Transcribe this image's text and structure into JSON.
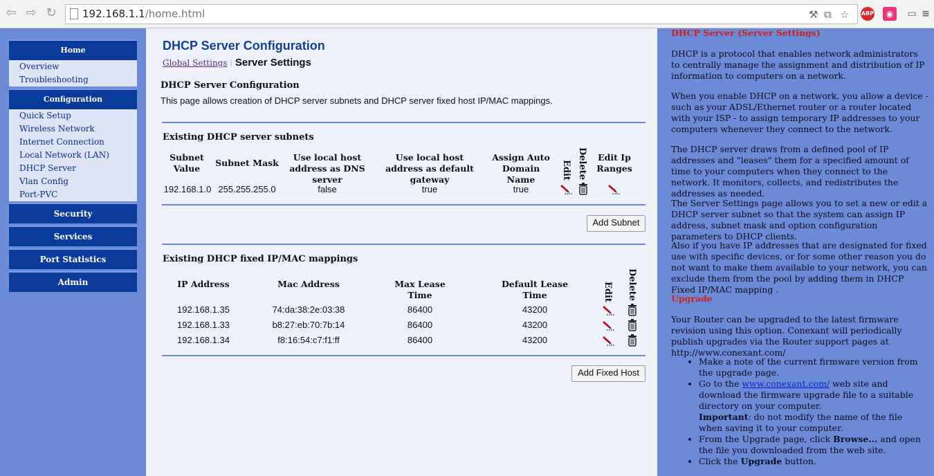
{
  "browser": {
    "url_host": "192.168.1.1",
    "url_path": "/home.html",
    "abp_label": "ABP"
  },
  "nav": {
    "home": "Home",
    "home_items": [
      "Overview",
      "Troubleshooting"
    ],
    "configuration": "Configuration",
    "config_items": [
      "Quick Setup",
      "Wireless Network",
      "Internet Connection",
      "Local Network (LAN)",
      "DHCP Server",
      "Vlan Config",
      "Port-PVC"
    ],
    "security": "Security",
    "services": "Services",
    "port_statistics": "Port Statistics",
    "admin": "Admin"
  },
  "main": {
    "title": "DHCP Server Configuration",
    "breadcrumb_link": "Global Settings",
    "breadcrumb_current": "Server Settings",
    "section_heading": "DHCP Server Configuration",
    "description": "This page allows creation of DHCP server subnets and DHCP server fixed host IP/MAC mappings.",
    "subnets": {
      "heading": "Existing DHCP server subnets",
      "columns": [
        "Subnet Value",
        "Subnet Mask",
        "Use local host address as DNS server",
        "Use local host address as default gateway",
        "Assign Auto Domain Name",
        "Edit",
        "Delete",
        "Edit Ip Ranges"
      ],
      "rows": [
        {
          "subnet": "192.168.1.0",
          "mask": "255.255.255.0",
          "dns": "false",
          "gateway": "true",
          "auto_domain": "true"
        }
      ],
      "add_button": "Add Subnet"
    },
    "hosts": {
      "heading": "Existing DHCP fixed IP/MAC mappings",
      "columns": [
        "IP Address",
        "Mac Address",
        "Max Lease Time",
        "Default Lease Time",
        "Edit",
        "Delete"
      ],
      "rows": [
        {
          "ip": "192.168.1.35",
          "mac": "74:da:38:2e:03:38",
          "max": "86400",
          "def": "43200"
        },
        {
          "ip": "192.168.1.33",
          "mac": "b8:27:eb:70:7b:14",
          "max": "86400",
          "def": "43200"
        },
        {
          "ip": "192.168.1.34",
          "mac": "f8:16:54:c7:f1:ff",
          "max": "86400",
          "def": "43200"
        }
      ],
      "add_button": "Add Fixed Host"
    }
  },
  "help": {
    "heading": "DHCP Server (Server Settings)",
    "p1": "DHCP is a protocol that enables network administrators to centrally manage the assignment and distribution of IP information to computers on a network.",
    "p2": "When you enable DHCP on a network, you allow a device - such as your ADSL/Ethernet router or a router located with your ISP - to assign temporary IP addresses to your computers whenever they connect to the network.",
    "p3": "The DHCP server draws from a defined pool of IP addresses and \"leases\" them for a specified amount of time to your computers when they connect to the network. It monitors, collects, and redistributes the addresses as needed.",
    "p4": "The Server Settings page allows you to set a new or edit a DHCP server subnet so that the system can assign IP address, subnet mask and option configuration parameters to DHCP clients.",
    "p5": "Also if you have IP addresses that are designated for fixed use with specific devices, or for some other reason you do not want to make them available to your network, you can exclude them from the pool by adding them in DHCP Fixed IP/MAC mapping .",
    "upgrade_heading": "Upgrade",
    "p6": "Your Router can be upgraded to the latest firmware revision using this option. Conexant will periodically publish upgrades via the Router support pages at http://www.conexant.com/",
    "li1": "Make a note of the current firmware version from the upgrade page.",
    "li2_pre": "Go to the ",
    "li2_link": "www.conexant.com/",
    "li2_post": " web site and download the firmware upgrade file to a suitable directory on your computer.",
    "li2_important": "Important",
    "li2_important_rest": ": do not modify the name of the file when saving it to your computer.",
    "li3_pre": "From the Upgrade page, click ",
    "li3_bold": "Browse...",
    "li3_post": " and open the file you downloaded from the web site.",
    "li4_pre": "Click the ",
    "li4_bold": "Upgrade",
    "li4_post": " button."
  },
  "colors": {
    "nav_header": "#0a3b9a",
    "panel_blue": "#6b8bd6",
    "help_heading": "#cc1f1f",
    "title": "#163f96"
  }
}
